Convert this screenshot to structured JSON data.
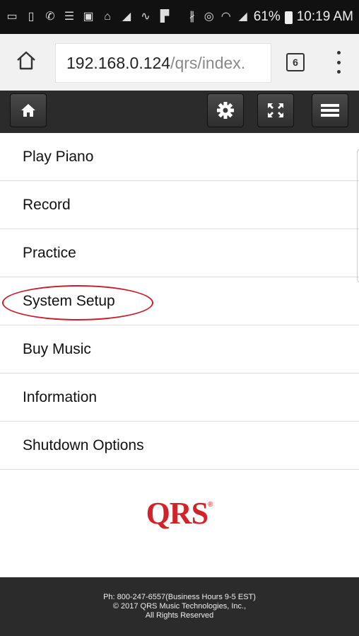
{
  "status_bar": {
    "battery": "61%",
    "time": "10:19 AM",
    "icons": [
      "messages-icon",
      "voicemail-icon",
      "notes-icon",
      "photo-icon",
      "home-icon",
      "signal-strength-icon",
      "fitness-icon",
      "flipboard-icon",
      "bluetooth-icon",
      "alarm-icon",
      "wifi-icon",
      "cell-signal-icon",
      "battery-icon"
    ]
  },
  "browser": {
    "url_host": "192.168.0.124",
    "url_path": "/qrs/index.",
    "tab_count": "6"
  },
  "toolbar": {
    "buttons": [
      "home",
      "settings",
      "fullscreen",
      "menu"
    ]
  },
  "menu": {
    "items": [
      {
        "label": "Play Piano"
      },
      {
        "label": "Record"
      },
      {
        "label": "Practice"
      },
      {
        "label": "System Setup"
      },
      {
        "label": "Buy Music"
      },
      {
        "label": "Information"
      },
      {
        "label": "Shutdown Options"
      }
    ],
    "highlighted": "System Setup"
  },
  "logo": {
    "text": "QRS",
    "registered": "®",
    "color": "#d2232a"
  },
  "footer": {
    "line1": "Ph: 800-247-6557(Business Hours 9-5 EST)",
    "line2": "© 2017 QRS Music Technologies, Inc.,",
    "line3": "All Rights Reserved"
  }
}
